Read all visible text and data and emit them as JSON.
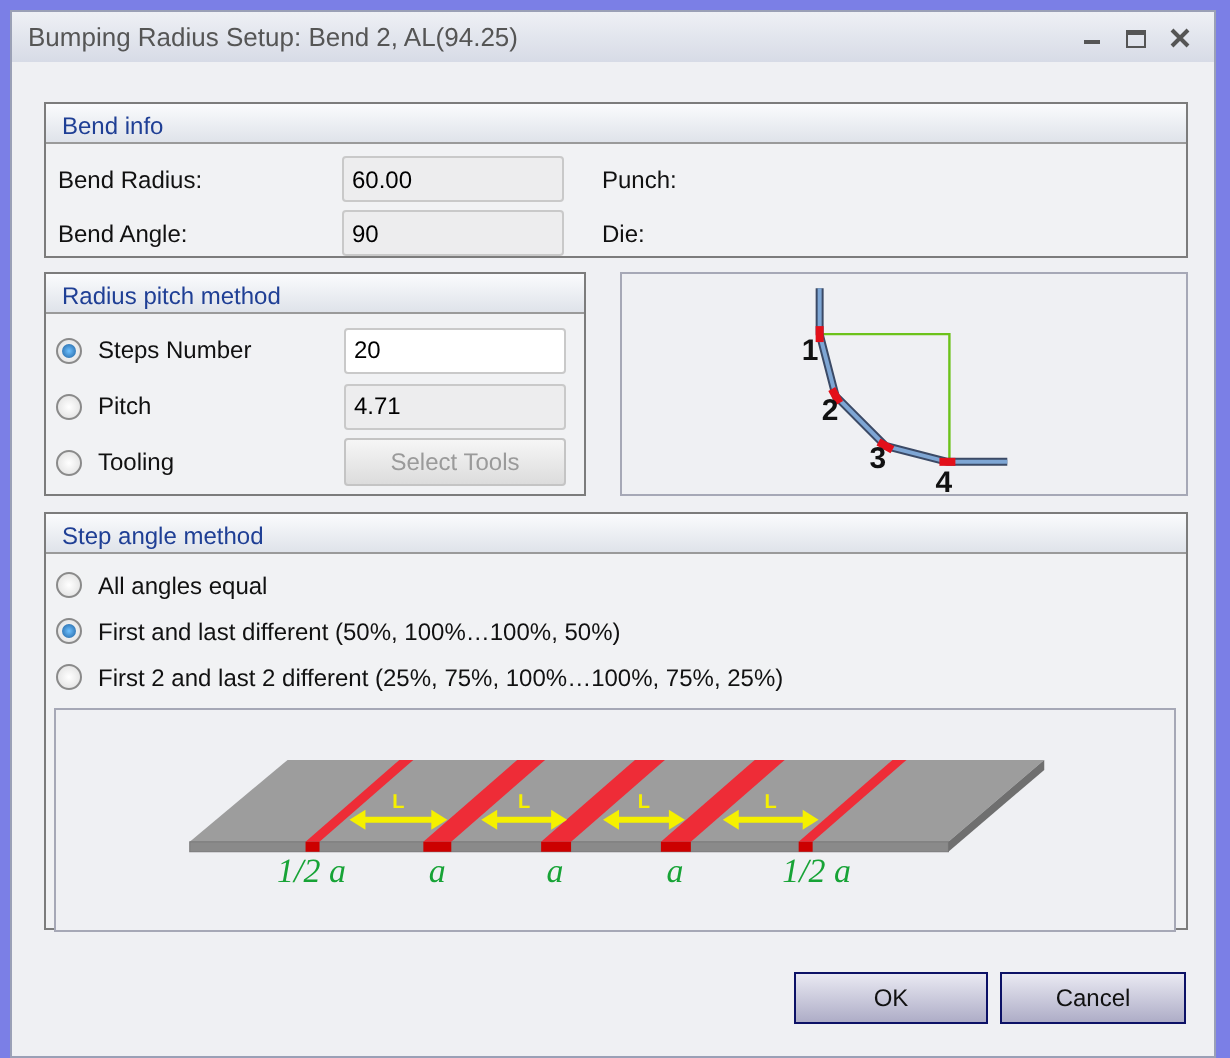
{
  "window": {
    "title": "Bumping Radius Setup: Bend 2, AL(94.25)"
  },
  "bend_info": {
    "title": "Bend info",
    "fields": [
      {
        "label": "Bend Radius:",
        "value": "60.00",
        "disabled": true
      },
      {
        "label": "Bend Angle:",
        "value": "90",
        "disabled": true
      }
    ],
    "side_labels": [
      "Punch:",
      "Die:"
    ]
  },
  "radius_pitch": {
    "title": "Radius pitch method",
    "options": [
      {
        "label": "Steps Number",
        "selected": true,
        "kind": "input",
        "value": "20",
        "disabled": false
      },
      {
        "label": "Pitch",
        "selected": false,
        "kind": "input",
        "value": "4.71",
        "disabled": true
      },
      {
        "label": "Tooling",
        "selected": false,
        "kind": "button",
        "button": "Select Tools",
        "disabled": true
      }
    ]
  },
  "bend_diagram": {
    "point_labels": [
      "1",
      "2",
      "3",
      "4"
    ]
  },
  "step_angle": {
    "title": "Step angle method",
    "options": [
      {
        "label": "All angles equal",
        "selected": false
      },
      {
        "label": "First and last different (50%, 100%…100%, 50%)",
        "selected": true
      },
      {
        "label": "First 2 and last 2 different (25%, 75%, 100%…100%, 75%, 25%)",
        "selected": false
      }
    ],
    "strip_diagram": {
      "spacing_labels": [
        "L",
        "L",
        "L",
        "L"
      ],
      "band_labels": [
        "1/2 a",
        "a",
        "a",
        "a",
        "1/2 a"
      ]
    }
  },
  "buttons": [
    "OK",
    "Cancel"
  ]
}
